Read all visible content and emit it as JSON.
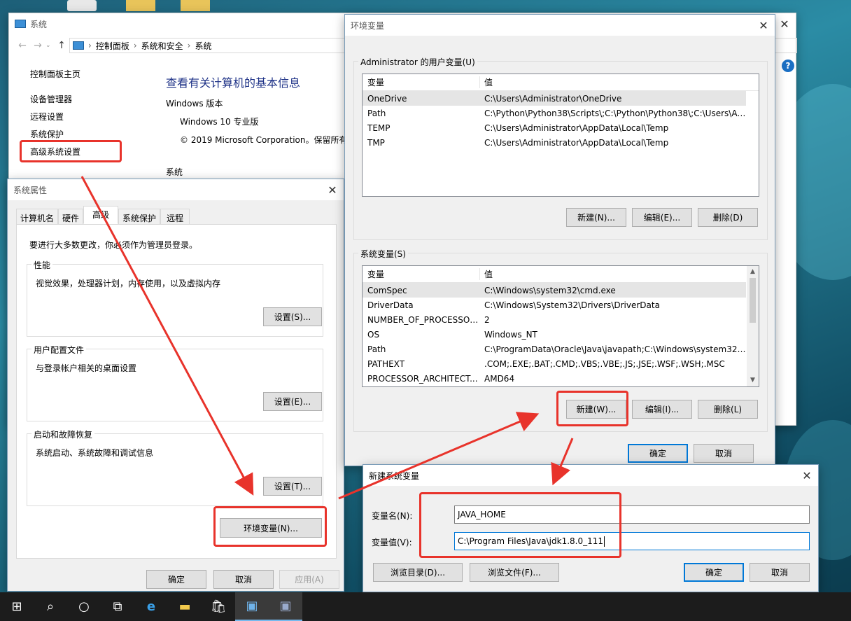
{
  "system_window": {
    "title": "系统",
    "breadcrumb": [
      "控制面板",
      "系统和安全",
      "系统"
    ],
    "sidebar": [
      "控制面板主页",
      "设备管理器",
      "远程设置",
      "系统保护",
      "高级系统设置"
    ],
    "heading": "查看有关计算机的基本信息",
    "windows_version_label": "Windows 版本",
    "edition": "Windows 10 专业版",
    "copyright": "© 2019 Microsoft Corporation。保留所有",
    "system_section": "系统"
  },
  "sysprops": {
    "title": "系统属性",
    "tabs": [
      "计算机名",
      "硬件",
      "高级",
      "系统保护",
      "远程"
    ],
    "admin_note": "要进行大多数更改，你必须作为管理员登录。",
    "perf": {
      "legend": "性能",
      "desc": "视觉效果，处理器计划，内存使用，以及虚拟内存",
      "button": "设置(S)..."
    },
    "profile": {
      "legend": "用户配置文件",
      "desc": "与登录帐户相关的桌面设置",
      "button": "设置(E)..."
    },
    "startup": {
      "legend": "启动和故障恢复",
      "desc": "系统启动、系统故障和调试信息",
      "button": "设置(T)..."
    },
    "envvars_button": "环境变量(N)...",
    "ok": "确定",
    "cancel": "取消",
    "apply": "应用(A)"
  },
  "envvars": {
    "title": "环境变量",
    "user_legend": "Administrator 的用户变量(U)",
    "col_var": "变量",
    "col_val": "值",
    "user_rows": [
      {
        "name": "OneDrive",
        "value": "C:\\Users\\Administrator\\OneDrive"
      },
      {
        "name": "Path",
        "value": "C:\\Python\\Python38\\Scripts\\;C:\\Python\\Python38\\;C:\\Users\\Ad..."
      },
      {
        "name": "TEMP",
        "value": "C:\\Users\\Administrator\\AppData\\Local\\Temp"
      },
      {
        "name": "TMP",
        "value": "C:\\Users\\Administrator\\AppData\\Local\\Temp"
      }
    ],
    "user_buttons": {
      "new": "新建(N)...",
      "edit": "编辑(E)...",
      "delete": "删除(D)"
    },
    "sys_legend": "系统变量(S)",
    "sys_rows": [
      {
        "name": "ComSpec",
        "value": "C:\\Windows\\system32\\cmd.exe"
      },
      {
        "name": "DriverData",
        "value": "C:\\Windows\\System32\\Drivers\\DriverData"
      },
      {
        "name": "NUMBER_OF_PROCESSORS",
        "value": "2"
      },
      {
        "name": "OS",
        "value": "Windows_NT"
      },
      {
        "name": "Path",
        "value": "C:\\ProgramData\\Oracle\\Java\\javapath;C:\\Windows\\system32;..."
      },
      {
        "name": "PATHEXT",
        "value": ".COM;.EXE;.BAT;.CMD;.VBS;.VBE;.JS;.JSE;.WSF;.WSH;.MSC"
      },
      {
        "name": "PROCESSOR_ARCHITECT...",
        "value": "AMD64"
      }
    ],
    "sys_buttons": {
      "new": "新建(W)...",
      "edit": "编辑(I)...",
      "delete": "删除(L)"
    },
    "ok": "确定",
    "cancel": "取消"
  },
  "newvar": {
    "title": "新建系统变量",
    "name_label": "变量名(N):",
    "name_value": "JAVA_HOME",
    "value_label": "变量值(V):",
    "value_value": "C:\\Program Files\\Java\\jdk1.8.0_111",
    "browse_dir": "浏览目录(D)...",
    "browse_file": "浏览文件(F)...",
    "ok": "确定",
    "cancel": "取消"
  },
  "colors": {
    "annotation_red": "#e8332b",
    "accent_blue": "#0078d7"
  }
}
